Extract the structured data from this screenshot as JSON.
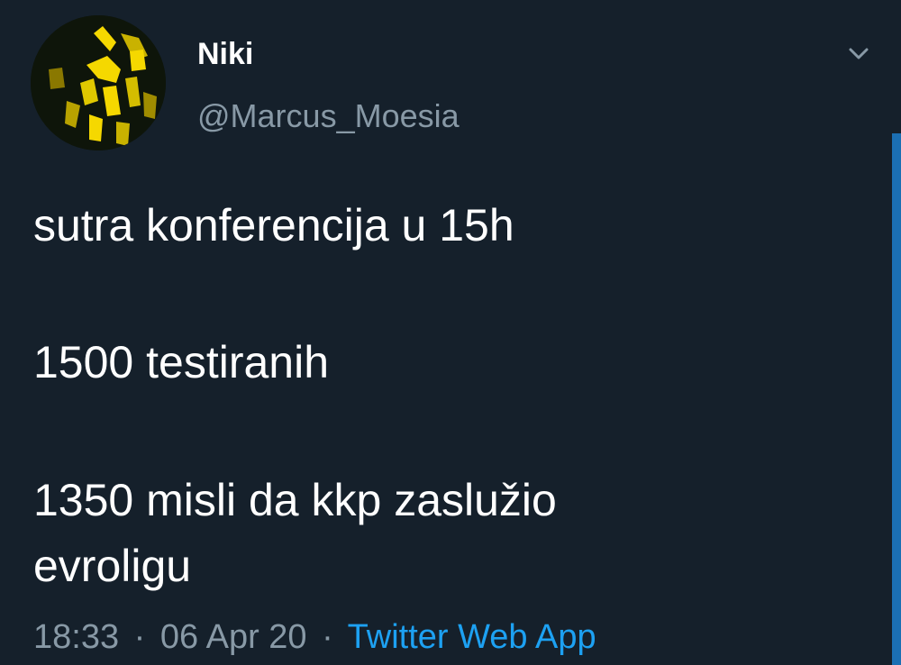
{
  "tweet": {
    "author": {
      "display_name": "Niki",
      "handle": "@Marcus_Moesia",
      "avatar_icon": "avatar-photo"
    },
    "menu_icon": "chevron-down-icon",
    "text_lines": [
      "sutra konferencija u 15h",
      "1500 testiranih",
      "1350 misli da kkp zaslužio",
      "evroligu"
    ],
    "time": "18:33",
    "date": "06 Apr 20",
    "separator": "·",
    "source": "Twitter Web App"
  },
  "colors": {
    "background": "#15202b",
    "text": "#ffffff",
    "secondary": "#8899a6",
    "link": "#1da1f2",
    "avatar_accent": "#f5d800"
  }
}
